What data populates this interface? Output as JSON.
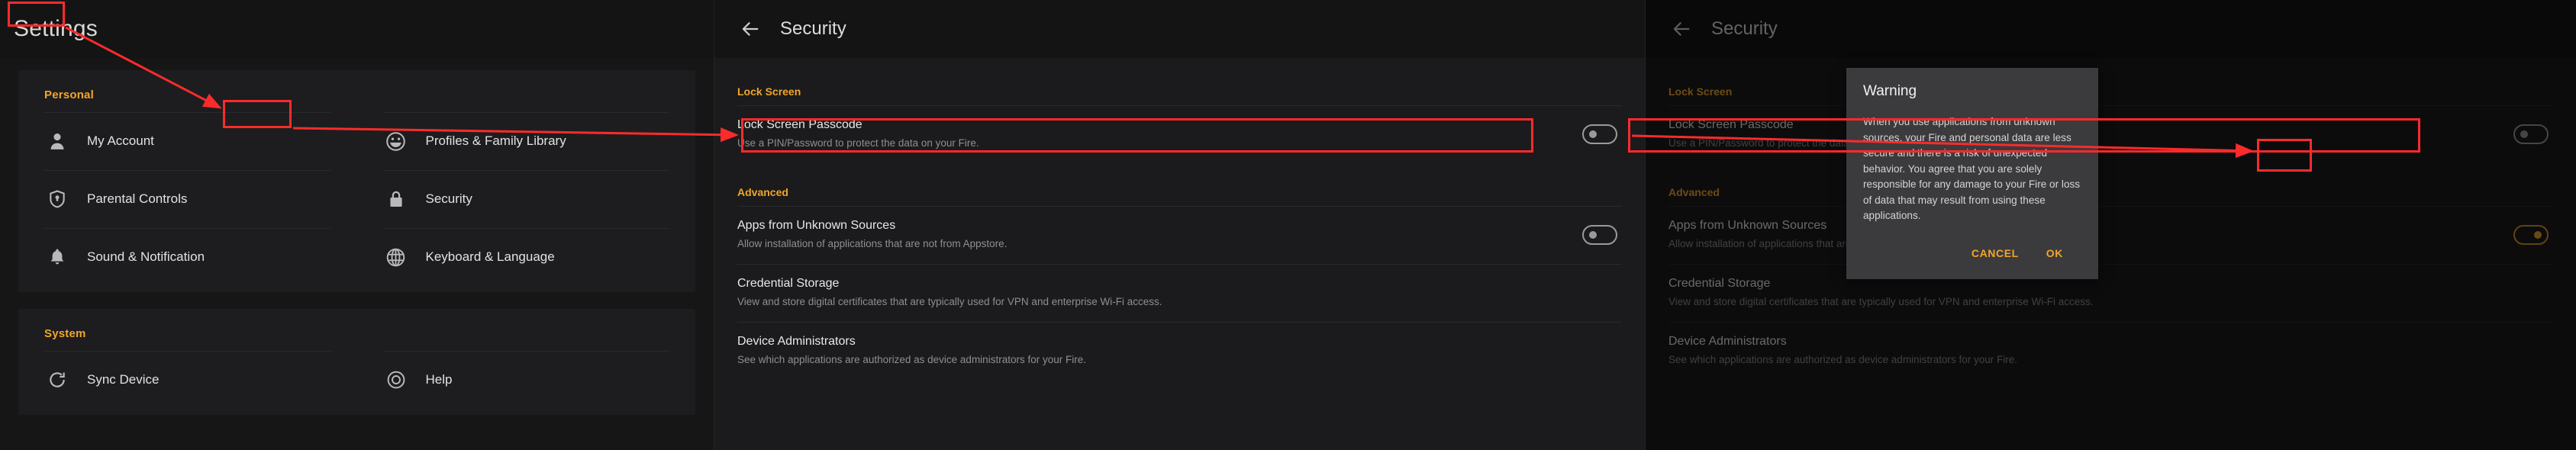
{
  "accent": "#f0a62a",
  "annotation_color": "#fb2b2b",
  "panel_settings": {
    "title": "Settings",
    "groups": [
      {
        "heading": "Personal",
        "items": [
          {
            "label": "My Account",
            "icon": "person-icon"
          },
          {
            "label": "Profiles & Family Library",
            "icon": "smiley-face-icon"
          },
          {
            "label": "Parental Controls",
            "icon": "shield-icon"
          },
          {
            "label": "Security",
            "icon": "lock-icon"
          },
          {
            "label": "Sound & Notification",
            "icon": "bell-icon"
          },
          {
            "label": "Keyboard & Language",
            "icon": "globe-icon"
          }
        ]
      },
      {
        "heading": "System",
        "items": [
          {
            "label": "Sync Device",
            "icon": "sync-icon"
          },
          {
            "label": "Help",
            "icon": "help-icon"
          }
        ]
      }
    ]
  },
  "panel_security": {
    "title": "Security",
    "back_icon": "back-arrow-icon",
    "sections": [
      {
        "heading": "Lock Screen",
        "rows": [
          {
            "title": "Lock Screen Passcode",
            "subtitle": "Use a PIN/Password to protect the data on your Fire.",
            "toggle": "off"
          }
        ]
      },
      {
        "heading": "Advanced",
        "rows": [
          {
            "title": "Apps from Unknown Sources",
            "subtitle": "Allow installation of applications that are not from Appstore.",
            "toggle": "off"
          },
          {
            "title": "Credential Storage",
            "subtitle": "View and store digital certificates that are typically used for VPN and enterprise Wi-Fi access.",
            "toggle": null
          },
          {
            "title": "Device Administrators",
            "subtitle": "See which applications are authorized as device administrators for your Fire.",
            "toggle": null
          }
        ]
      }
    ]
  },
  "panel_security_dialog": {
    "title": "Security",
    "back_icon": "back-arrow-icon",
    "unknown_sources_toggle": "on",
    "sections": [
      {
        "heading": "Lock Screen",
        "rows": [
          {
            "title": "Lock Screen Passcode",
            "subtitle": "Use a PIN/Password to protect the data on your Fire.",
            "toggle": "off"
          }
        ]
      },
      {
        "heading": "Advanced",
        "rows": [
          {
            "title": "Apps from Unknown Sources",
            "subtitle": "Allow installation of applications that are not from Appstore.",
            "toggle": "on"
          },
          {
            "title": "Credential Storage",
            "subtitle": "View and store digital certificates that are typically used for VPN and enterprise Wi-Fi access.",
            "toggle": null
          },
          {
            "title": "Device Administrators",
            "subtitle": "See which applications are authorized as device administrators for your Fire.",
            "toggle": null
          }
        ]
      }
    ],
    "dialog": {
      "title": "Warning",
      "body": "When you use applications from unknown sources, your Fire and personal data are less secure and there is a risk of unexpected behavior. You agree that you are solely responsible for any damage to your Fire or loss of data that may result from using these applications.",
      "cancel_label": "CANCEL",
      "ok_label": "OK"
    }
  }
}
